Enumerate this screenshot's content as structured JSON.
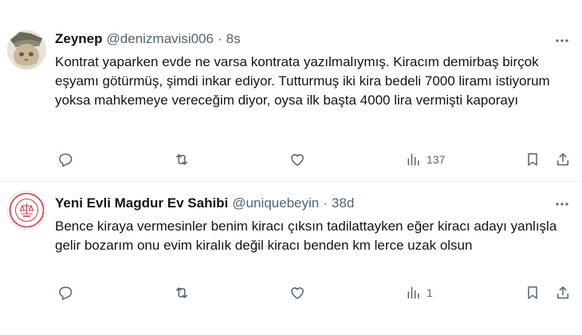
{
  "tweets": [
    {
      "name": "Zeynep",
      "handle": "@denizmavisi006",
      "separator": "·",
      "time": "8s",
      "text": "Kontrat yaparken evde ne varsa kontrata yazılmalıymış. Kiracım demirbaş birçok eşyamı götürmüş, şimdi inkar ediyor. Tutturmuş iki kira bedeli 7000 liramı istiyorum yoksa mahkemeye vereceğim diyor, oysa ilk başta 4000 lira vermişti kaporayı",
      "views": "137"
    },
    {
      "name": "Yeni Evli Magdur Ev Sahibi",
      "handle": "@uniquebeyin",
      "separator": "·",
      "time": "38d",
      "text": "Bence kiraya vermesinler benim kiracı çıksın tadilattayken eğer kiracı adayı yanlışla gelir bozarım onu evim kiralık değil kiracı benden km lerce uzak olsun",
      "views": "1",
      "avatar_logo_text": "KİRACI AKTİF"
    }
  ],
  "colors": {
    "text": "#0f1419",
    "secondary": "#536471",
    "divider": "#eff3f4",
    "logo_red": "#d9363e"
  },
  "icons": [
    "more-icon",
    "reply-icon",
    "retweet-icon",
    "like-icon",
    "views-icon",
    "bookmark-icon",
    "share-icon"
  ]
}
